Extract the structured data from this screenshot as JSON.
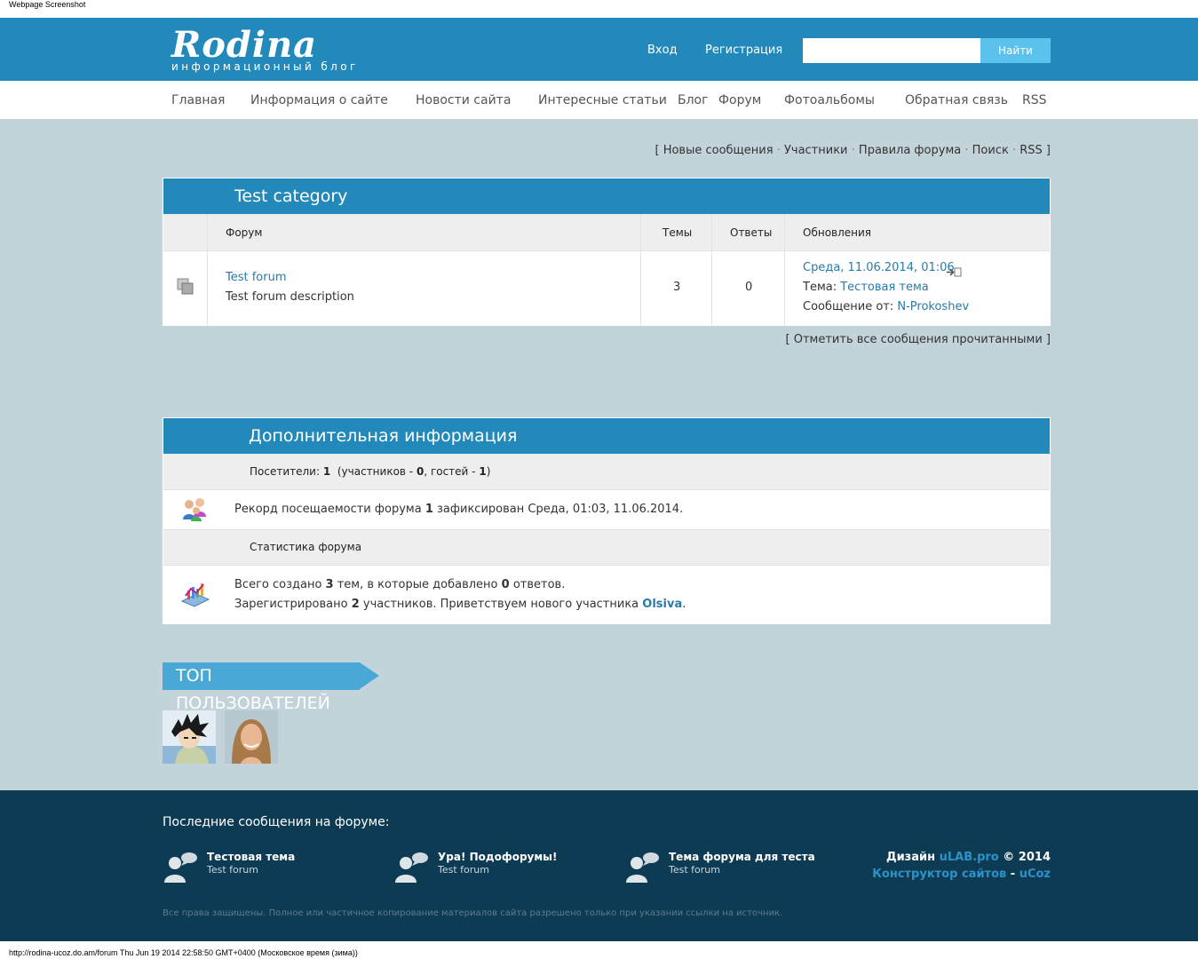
{
  "caption": "Webpage Screenshot",
  "footnote": "http://rodina-ucoz.do.am/forum Thu Jun 19 2014 22:58:50 GMT+0400 (Московское время (зима))",
  "header": {
    "logo_title": "Rodina",
    "logo_subtitle": "информационный блог",
    "login": "Вход",
    "register": "Регистрация",
    "search_value": "",
    "search_button": "Найти"
  },
  "nav": [
    "Главная",
    "Информация о сайте",
    "Новости сайта",
    "Интересные статьи",
    "Блог",
    "Форум",
    "Фотоальбомы",
    "Обратная связь",
    "RSS"
  ],
  "forum_links": {
    "new_messages": "Новые сообщения",
    "members": "Участники",
    "rules": "Правила форума",
    "search": "Поиск",
    "rss": "RSS"
  },
  "category": {
    "title": "Test category",
    "col_forum": "Форум",
    "col_topics": "Темы",
    "col_replies": "Ответы",
    "col_updates": "Обновления",
    "forum_name": "Test forum",
    "forum_desc": "Test forum description",
    "topics": "3",
    "replies": "0",
    "last_date": "Среда, 11.06.2014, 01:06",
    "topic_label": "Тема:",
    "topic_name": "Тестовая тема",
    "msg_label": "Сообщение от:",
    "msg_author": "N-Prokoshev"
  },
  "mark_read": "Отметить все сообщения прочитанными",
  "info": {
    "title": "Дополнительная информация",
    "visitors_label": "Посетители:",
    "visitors": "1",
    "members_label": "(участников -",
    "members_count": "0",
    "guests_label": ", гостей -",
    "guests_count": "1",
    "record_pre": "Рекорд посещаемости форума",
    "record_num": "1",
    "record_post": "зафиксирован Среда, 01:03, 11.06.2014.",
    "stats_title": "Статистика форума",
    "stats1_a": "Всего создано",
    "stats1_topics": "3",
    "stats1_b": "тем, в которые добавлено",
    "stats1_replies": "0",
    "stats1_c": "ответов.",
    "stats2_a": "Зарегистрировано",
    "stats2_users": "2",
    "stats2_b": "участников. Приветствуем нового участника",
    "stats2_new": "Olsiva"
  },
  "top_users_title": "ТОП ПОЛЬЗОВАТЕЛЕЙ",
  "footer": {
    "title": "Последние сообщения на форуме:",
    "posts": [
      {
        "title": "Тестовая тема",
        "forum": "Test forum"
      },
      {
        "title": "Ура! Подофорумы!",
        "forum": "Test forum"
      },
      {
        "title": "Тема форума для теста",
        "forum": "Test forum"
      }
    ],
    "design_label": "Дизайн",
    "design_link": "uLAB.pro",
    "design_year": "© 2014",
    "constructor": "Конструктор сайтов",
    "ucoz": "uCoz",
    "rights": "Все права защищены. Полное или частичное копирование материалов сайта разрешено только при указании ссылки на источник."
  },
  "colors": {
    "header_blue": "#2389bb",
    "footer_navy": "#0e3b54",
    "page_bg": "#c3d3da",
    "link_blue": "#2a7aa6"
  }
}
